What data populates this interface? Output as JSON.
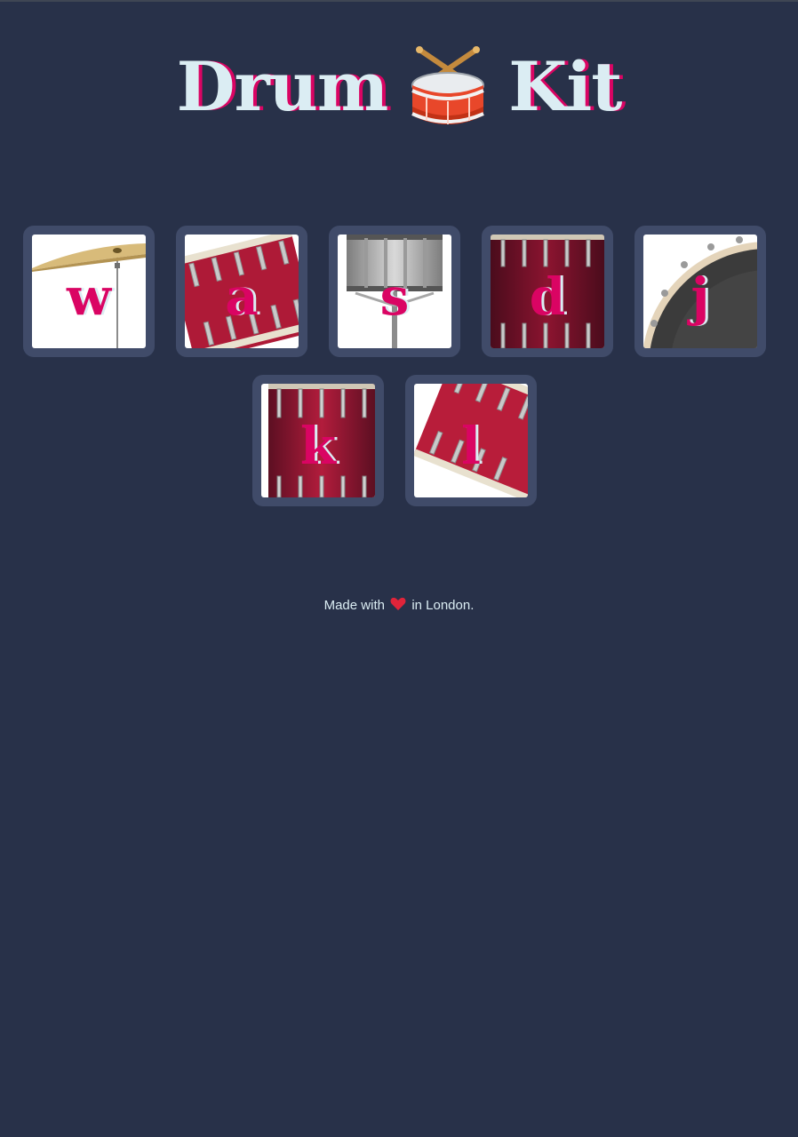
{
  "title": {
    "before": "Drum",
    "after": "Kit",
    "emoji_icon": "drum-icon"
  },
  "pads": [
    {
      "key": "w",
      "instrument_icon": "crash-cymbal-icon"
    },
    {
      "key": "a",
      "instrument_icon": "tom-drum-icon"
    },
    {
      "key": "s",
      "instrument_icon": "snare-drum-icon"
    },
    {
      "key": "d",
      "instrument_icon": "tom-drum-icon"
    },
    {
      "key": "j",
      "instrument_icon": "bass-drum-icon"
    },
    {
      "key": "k",
      "instrument_icon": "tom-drum-icon"
    },
    {
      "key": "l",
      "instrument_icon": "tom-drum-icon"
    }
  ],
  "footer": {
    "before": "Made with",
    "after": "in London.",
    "icon": "heart-icon"
  },
  "colors": {
    "background": "#283149",
    "pad_frame": "#404b69",
    "accent": "#da0463",
    "text": "#dbedf3"
  }
}
